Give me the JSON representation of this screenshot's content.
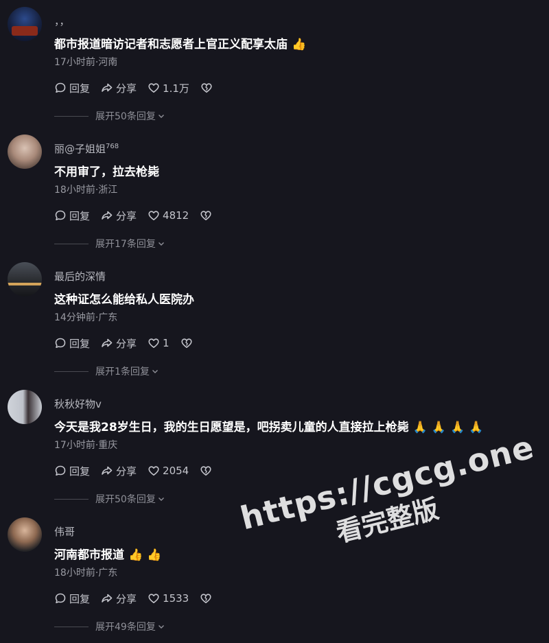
{
  "comments": [
    {
      "username": "，，",
      "username_sup": "",
      "text": "都市报道暗访记者和志愿者上官正义配享太庙",
      "emojis": [
        "👍"
      ],
      "meta": "17小时前·河南",
      "reply_label": "回复",
      "share_label": "分享",
      "likes": "1.1万",
      "expand_label": "展开50条回复"
    },
    {
      "username": "丽@子姐姐",
      "username_sup": "768",
      "text": "不用审了，拉去枪毙",
      "emojis": [],
      "meta": "18小时前·浙江",
      "reply_label": "回复",
      "share_label": "分享",
      "likes": "4812",
      "expand_label": "展开17条回复"
    },
    {
      "username": "最后的深情",
      "username_sup": "",
      "text": "这种证怎么能给私人医院办",
      "emojis": [],
      "meta": "14分钟前·广东",
      "reply_label": "回复",
      "share_label": "分享",
      "likes": "1",
      "expand_label": "展开1条回复"
    },
    {
      "username": "秋秋好物v",
      "username_sup": "",
      "text": "今天是我28岁生日，我的生日愿望是，吧拐卖儿童的人直接拉上枪毙",
      "emojis": [
        "🙏",
        "🙏",
        "🙏",
        "🙏"
      ],
      "meta": "17小时前·重庆",
      "reply_label": "回复",
      "share_label": "分享",
      "likes": "2054",
      "expand_label": "展开50条回复"
    },
    {
      "username": "伟哥",
      "username_sup": "",
      "text": "河南都市报道",
      "emojis": [
        "👍",
        "👍"
      ],
      "meta": "18小时前·广东",
      "reply_label": "回复",
      "share_label": "分享",
      "likes": "1533",
      "expand_label": "展开49条回复"
    }
  ],
  "watermark": {
    "url": "https://cgcg.one",
    "subtitle": "看完整版"
  },
  "colors": {
    "background": "#16161e",
    "text_primary": "#ffffff",
    "text_secondary": "#9a9ba3",
    "emoji_yellow": "#f6b52c"
  },
  "icons": [
    "comment-bubble-icon",
    "share-arrow-icon",
    "heart-icon",
    "broken-heart-icon",
    "chevron-down-icon"
  ]
}
